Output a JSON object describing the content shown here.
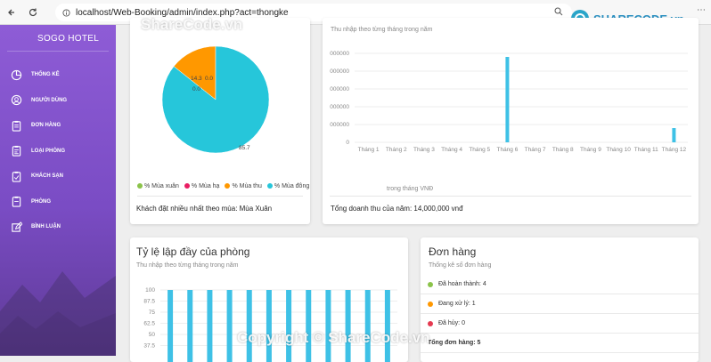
{
  "browser": {
    "url": "localhost/Web-Booking/admin/index.php?act=thongke"
  },
  "sidebar": {
    "brand": "SOGO HOTEL",
    "items": [
      {
        "label": "THỐNG KÊ",
        "icon": "chart-pie-icon"
      },
      {
        "label": "NGƯỜI DÙNG",
        "icon": "user-icon"
      },
      {
        "label": "ĐƠN HÀNG",
        "icon": "clipboard-icon"
      },
      {
        "label": "LOẠI PHÒNG",
        "icon": "clipboard-list-icon"
      },
      {
        "label": "KHÁCH SẠN",
        "icon": "clipboard-check-icon"
      },
      {
        "label": "PHÒNG",
        "icon": "clipboard-icon"
      },
      {
        "label": "BÌNH LUẬN",
        "icon": "edit-icon"
      }
    ]
  },
  "season_card": {
    "legend": [
      "% Mùa xuân",
      "% Mùa hạ",
      "% Mùa thu",
      "% Mùa đông"
    ],
    "legend_colors": [
      "#8bc34a",
      "#e91e63",
      "#ff9800",
      "#26c6da"
    ],
    "footer": "Khách đặt nhiều nhất theo mùa: Mùa Xuân"
  },
  "revenue_card": {
    "subtitle": "Thu nhập theo từng tháng trong năm",
    "note": "trong tháng VNĐ",
    "footer": "Tổng doanh thu của năm: 14,000,000 vnđ"
  },
  "occupancy_card": {
    "title": "Tỷ lệ lập đầy của phòng",
    "subtitle": "Thu nhập theo từng tháng trong năm"
  },
  "orders_card": {
    "title": "Đơn hàng",
    "subtitle": "Thống kê số đơn hàng",
    "items": [
      {
        "label": "Đã hoàn thành: 4",
        "color": "#8bc34a"
      },
      {
        "label": "Đang xử lý: 1",
        "color": "#ff9800"
      },
      {
        "label": "Đã hủy: 0",
        "color": "#e53950"
      }
    ],
    "total": "Tổng đơn hàng: 5"
  },
  "watermarks": {
    "top": "ShareCode.vn",
    "bottom": "Copyright © ShareCode.vn",
    "logo": "SHARECODE.vn"
  },
  "chart_data": [
    {
      "type": "pie",
      "categories": [
        "% Mùa xuân",
        "% Mùa hạ",
        "% Mùa thu",
        "% Mùa đông"
      ],
      "values": [
        0.0,
        0.0,
        14.3,
        85.7
      ],
      "data_labels": [
        "0.0",
        "0.0",
        "14.3",
        "85.7"
      ],
      "legend": "bottom"
    },
    {
      "type": "bar",
      "categories": [
        "Tháng 1",
        "Tháng 2",
        "Tháng 3",
        "Tháng 4",
        "Tháng 5",
        "Tháng 6",
        "Tháng 7",
        "Tháng 8",
        "Tháng 9",
        "Tháng 10",
        "Tháng 11",
        "Tháng 12"
      ],
      "values": [
        0,
        0,
        0,
        0,
        0,
        12000000,
        0,
        0,
        0,
        0,
        0,
        2000000
      ],
      "y_tick_labels": [
        "0",
        "000000",
        "000000",
        "000000",
        "000000",
        "000000"
      ],
      "grid": true
    },
    {
      "type": "bar",
      "y_tick_labels": [
        "100",
        "87.5",
        "75",
        "62.5",
        "50",
        "37.5"
      ],
      "values": [
        100,
        100,
        100,
        100,
        100,
        100,
        100,
        100,
        100,
        100,
        100,
        100
      ],
      "grid": true
    }
  ]
}
